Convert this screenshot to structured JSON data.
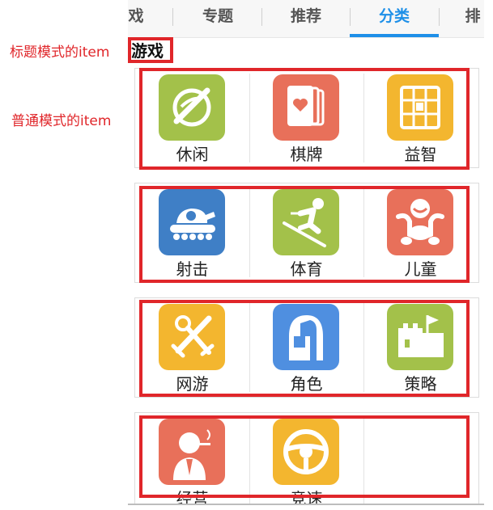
{
  "annotations": {
    "title_mode_item": "标题模式的item",
    "normal_mode_item": "普通模式的item"
  },
  "tabs": [
    {
      "label": "戏",
      "active": false
    },
    {
      "label": "专题",
      "active": false
    },
    {
      "label": "推荐",
      "active": false
    },
    {
      "label": "分类",
      "active": true
    },
    {
      "label": "排",
      "active": false
    }
  ],
  "section_title": "游戏",
  "rows": [
    [
      {
        "label": "休闲",
        "icon": "leaf-ball-icon",
        "color": "#a3c14a"
      },
      {
        "label": "棋牌",
        "icon": "playing-cards-icon",
        "color": "#e8705a"
      },
      {
        "label": "益智",
        "icon": "puzzle-grid-icon",
        "color": "#f3b62f"
      }
    ],
    [
      {
        "label": "射击",
        "icon": "tank-icon",
        "color": "#3f7fc6"
      },
      {
        "label": "体育",
        "icon": "skier-icon",
        "color": "#a3c14a"
      },
      {
        "label": "儿童",
        "icon": "child-icon",
        "color": "#e8705a"
      }
    ],
    [
      {
        "label": "网游",
        "icon": "crossed-swords-icon",
        "color": "#f3b62f"
      },
      {
        "label": "角色",
        "icon": "knight-helmet-icon",
        "color": "#4f8fe0"
      },
      {
        "label": "策略",
        "icon": "castle-icon",
        "color": "#a3c14a"
      }
    ],
    [
      {
        "label": "经营",
        "icon": "business-person-icon",
        "color": "#e8705a"
      },
      {
        "label": "竞速",
        "icon": "steering-wheel-icon",
        "color": "#f3b62f"
      }
    ]
  ],
  "colors": {
    "highlight": "#e0262a",
    "accent": "#1e90e8"
  }
}
